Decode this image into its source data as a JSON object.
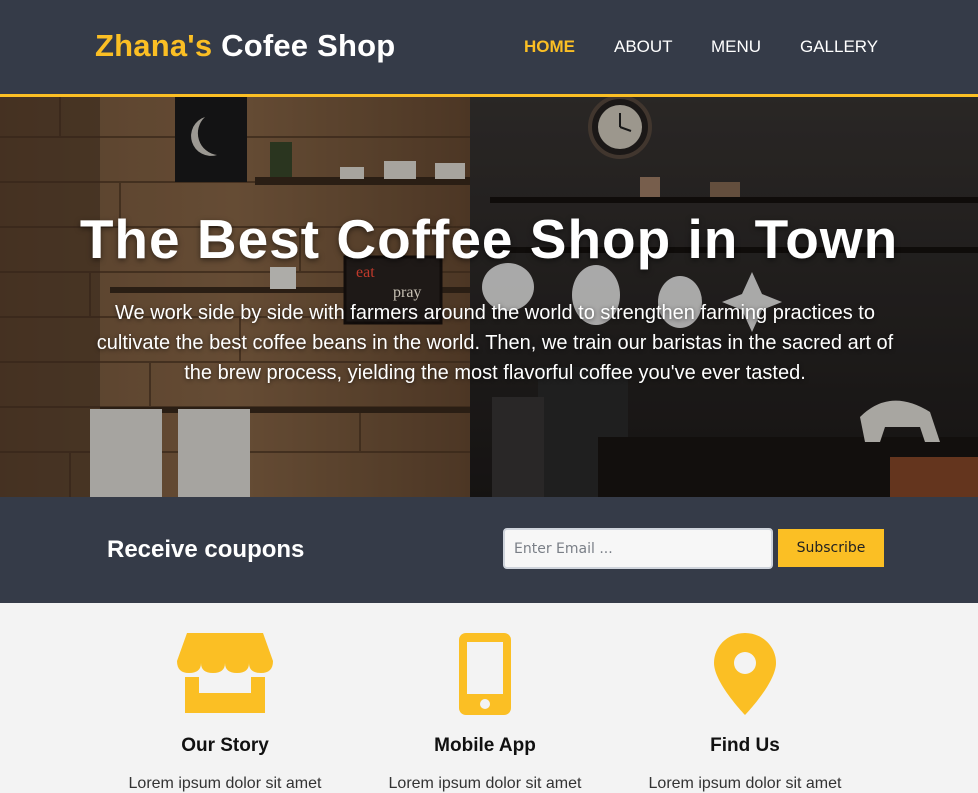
{
  "header": {
    "logo_accent": "Zhana's",
    "logo_rest": " Cofee Shop",
    "nav": [
      {
        "label": "HOME",
        "active": true
      },
      {
        "label": "ABOUT",
        "active": false
      },
      {
        "label": "MENU",
        "active": false
      },
      {
        "label": "GALLERY",
        "active": false
      }
    ]
  },
  "hero": {
    "title": "The Best Coffee Shop in Town",
    "text": "We work side by side with farmers around the world to strengthen farming practices to cultivate the best coffee beans in the world. Then, we train our baristas in the sacred art of the brew process, yielding the most flavorful coffee you've ever tasted.",
    "sign_text_1": "eat",
    "sign_text_2": "pray"
  },
  "coupons": {
    "label": "Receive coupons",
    "email_placeholder": "Enter Email ...",
    "email_value": "",
    "subscribe_label": "Subscribe"
  },
  "features": [
    {
      "icon": "store-icon",
      "title": "Our Story",
      "text": "Lorem ipsum dolor sit amet"
    },
    {
      "icon": "mobile-phone-icon",
      "title": "Mobile App",
      "text": "Lorem ipsum dolor sit amet"
    },
    {
      "icon": "map-marker-icon",
      "title": "Find Us",
      "text": "Lorem ipsum dolor sit amet"
    }
  ],
  "colors": {
    "accent": "#fbbf24",
    "dark": "#353b48",
    "light_bg": "#f3f3f3"
  }
}
